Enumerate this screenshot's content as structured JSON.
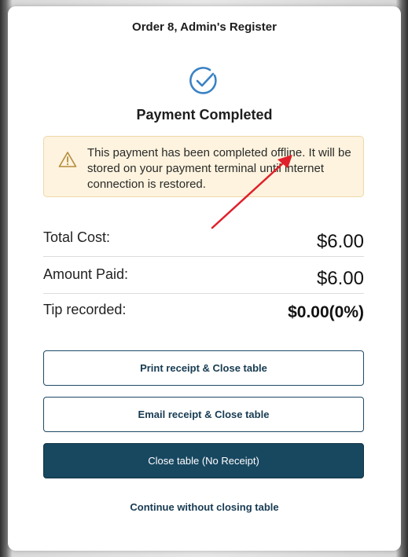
{
  "modal": {
    "title": "Order 8, Admin's Register",
    "status_icon": "check-circle-icon",
    "headline": "Payment Completed"
  },
  "warning": {
    "icon": "warning-triangle-icon",
    "text": "This payment has been completed offline. It will be stored on your payment terminal until internet connection is restored."
  },
  "summary": {
    "rows": [
      {
        "label": "Total Cost:",
        "value": "$6.00"
      },
      {
        "label": "Amount Paid:",
        "value": "$6.00"
      },
      {
        "label": "Tip recorded:",
        "value": "$0.00(0%)"
      }
    ]
  },
  "actions": {
    "print_label": "Print receipt & Close table",
    "email_label": "Email receipt & Close table",
    "close_label": "Close table (No Receipt)",
    "continue_label": "Continue without closing table"
  },
  "colors": {
    "accent": "#184760",
    "check": "#3b82c4",
    "warning_bg": "#fdf3de",
    "annotation": "#e0202a"
  }
}
